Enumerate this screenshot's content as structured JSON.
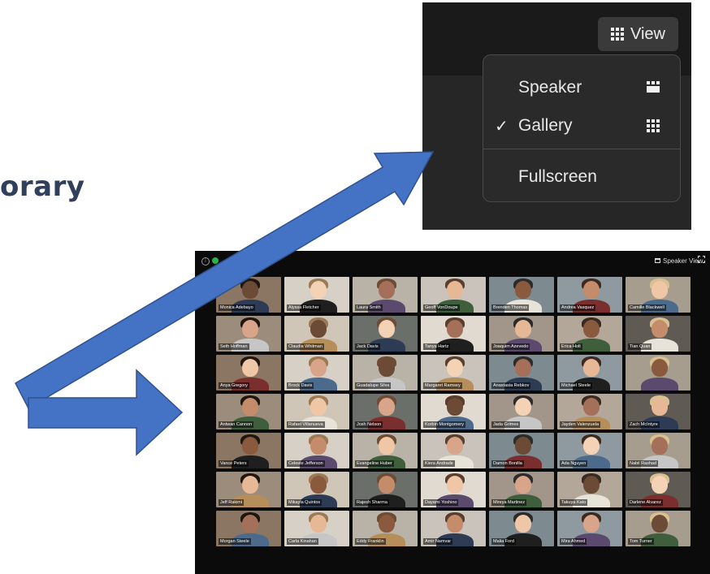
{
  "slide": {
    "title_fragment": "orary"
  },
  "menu": {
    "view_button_label": "View",
    "items": [
      {
        "label": "Speaker",
        "checked": false,
        "icon": "speaker-layout-icon"
      },
      {
        "label": "Gallery",
        "checked": true,
        "icon": "gallery-grid-icon"
      },
      {
        "label": "Fullscreen",
        "checked": false,
        "icon": ""
      }
    ],
    "check_glyph": "✓"
  },
  "gallery": {
    "speaker_view_label": "Speaker View",
    "participants": [
      "Monica Adebayo",
      "Alyssa Fletcher",
      "Laura Smith",
      "Geoff VonDoupe",
      "Brenden Thomas",
      "Andrea Vasquez",
      "Camille Blackwell",
      "Seth Hoffman",
      "Claudia Whitman",
      "Jack Davis",
      "Tanya Hartz",
      "Joaquim Azevedo",
      "Erica Holt",
      "Tian Quan",
      "Anya Gregory",
      "Brock Davis",
      "Guadalupe Silva",
      "Margaret Ramsey",
      "Anastasia Rebkov",
      "Michael Steele",
      "",
      "Antwan Cannon",
      "Rafael Villanueva",
      "Josh Nelson",
      "Korbin Montgomery",
      "Jada Grimes",
      "Jayden Valenzuela",
      "Zach McIntyre",
      "Vance Peters",
      "Celeste Jefferson",
      "Evangeline Huber",
      "Kiera Andrade",
      "Damon Bonilla",
      "Ada Nguyen",
      "Nabil Rashad",
      "Jeff Rakimi",
      "Mikayla Quintos",
      "Rajesh Sharma",
      "Dayami Yoshino",
      "Mireya Martinez",
      "Takuya Kato",
      "Darlene Alvarez",
      "Morgan Steele",
      "Carla Kinahan",
      "Eddy Franklin",
      "Amir Namvar",
      "Malia Ford",
      "Mira Ahmed",
      "Tom Turner"
    ]
  },
  "colors": {
    "arrow_fill": "#4472c4",
    "arrow_stroke": "#2f528f",
    "title": "#2f3f5c",
    "menu_background": "#262626",
    "dropdown_background": "#2a2a2a"
  }
}
